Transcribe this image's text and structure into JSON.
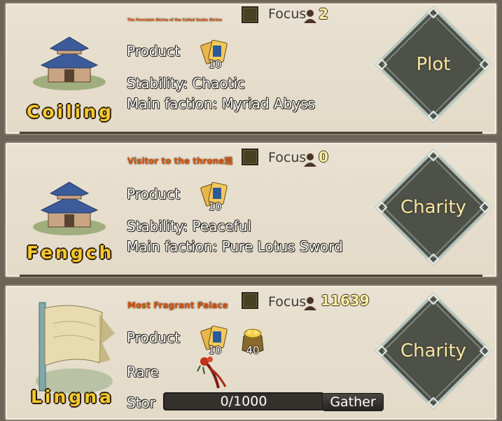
{
  "towns": [
    {
      "name": "Coiling",
      "subtitle": "The Porcelain Shrine of the Coiled Snake Shrine",
      "focus_label": "Focus",
      "focus_count": "2",
      "product_label": "Product",
      "products": [
        {
          "icon": "paper-scrolls-icon",
          "count": "10"
        }
      ],
      "line2": "Stability: Chaotic",
      "line3": "Main faction: Myriad Abyss",
      "action_label": "Plot"
    },
    {
      "name": "Fengch",
      "subtitle": "Visitor to the throne观",
      "focus_label": "Focus",
      "focus_count": "0",
      "product_label": "Product",
      "products": [
        {
          "icon": "paper-scrolls-icon",
          "count": "10"
        }
      ],
      "line2": "Stability: Peaceful",
      "line3": "Main faction: Pure Lotus Sword",
      "action_label": "Charity"
    },
    {
      "name": "Lingna",
      "subtitle": "Most Fragrant  Palace",
      "focus_label": "Focus",
      "focus_count": "11639",
      "product_label": "Product",
      "products": [
        {
          "icon": "paper-scrolls-icon",
          "count": "10"
        },
        {
          "icon": "gold-sack-icon",
          "count": "40"
        }
      ],
      "rare_label": "Rare",
      "rare_icon": "red-herb-icon",
      "storage_label": "Stor",
      "storage_value": "0/1000",
      "gather_label": "Gather",
      "action_label": "Charity"
    }
  ],
  "colors": {
    "town_name": "#f6c92e",
    "subtitle": "#d2550e",
    "diamond": "#4e5148",
    "diamond_border": "#b8c6c0",
    "diamond_text": "#fbe6a3"
  }
}
